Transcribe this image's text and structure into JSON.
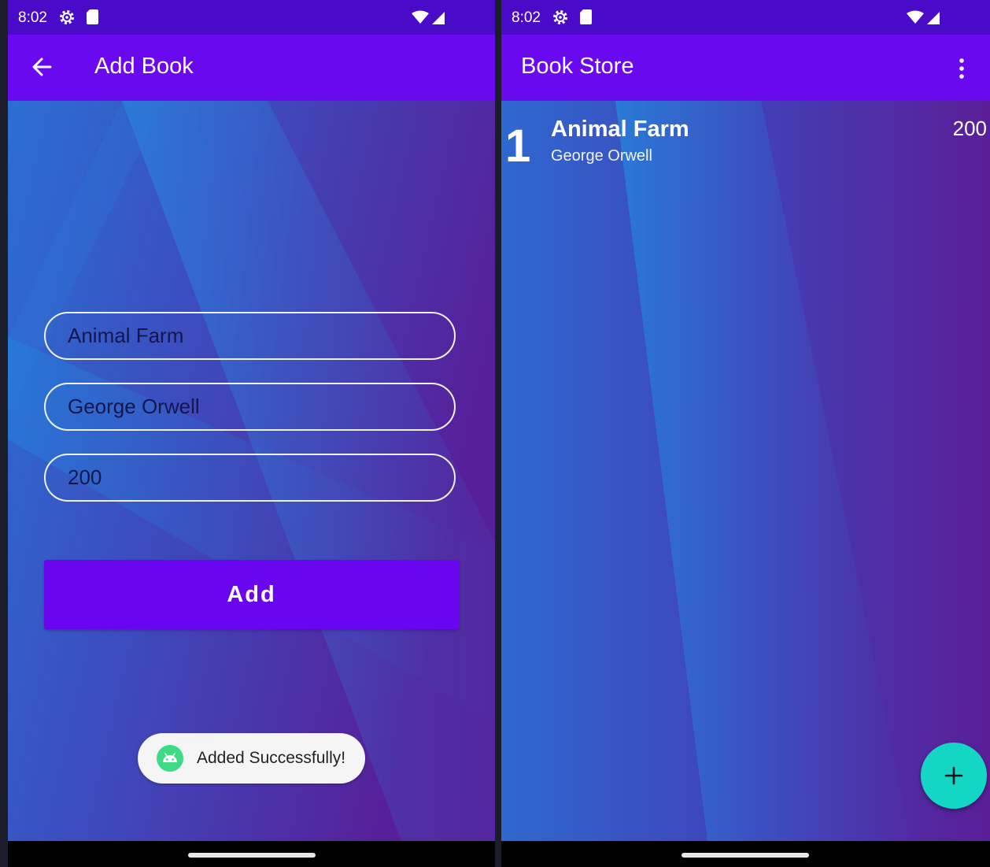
{
  "left_screen": {
    "status_bar": {
      "time": "8:02"
    },
    "app_bar": {
      "title": "Add Book",
      "back_icon": "arrow-left-icon"
    },
    "form": {
      "title_value": "Animal Farm",
      "author_value": "George Orwell",
      "price_value": "200",
      "add_label": "Add"
    },
    "toast": {
      "text": "Added Successfully!",
      "icon": "android-icon"
    }
  },
  "right_screen": {
    "status_bar": {
      "time": "8:02"
    },
    "app_bar": {
      "title": "Book Store",
      "menu_icon": "more-vert-icon"
    },
    "books": [
      {
        "index": "1",
        "title": "Animal Farm",
        "author": "George Orwell",
        "price": "200"
      }
    ],
    "fab": {
      "icon": "plus-icon"
    }
  },
  "colors": {
    "status_bar": "#4a0bc9",
    "app_bar": "#6a08f0",
    "button": "#6906ef",
    "fab": "#14d6c4",
    "bg_blue": "#2a7ed8",
    "bg_purple": "#5a1e98"
  }
}
